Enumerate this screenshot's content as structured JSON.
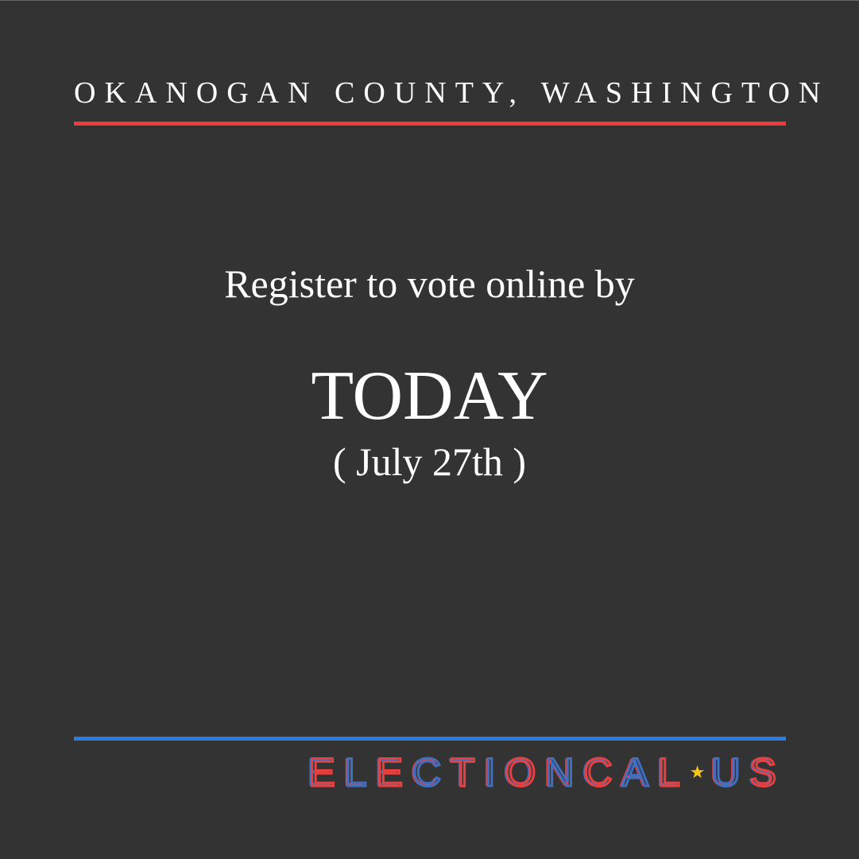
{
  "header": {
    "county": "OKANOGAN COUNTY, WASHINGTON"
  },
  "main": {
    "line1": "Register to vote online by",
    "deadline": "TODAY",
    "date": "( July 27th )"
  },
  "footer": {
    "logo_left": "ELECTIONCAL",
    "logo_right": "US"
  },
  "colors": {
    "background": "#333333",
    "red": "#f23a3a",
    "blue": "#2a7de1",
    "star": "#f5c518"
  }
}
